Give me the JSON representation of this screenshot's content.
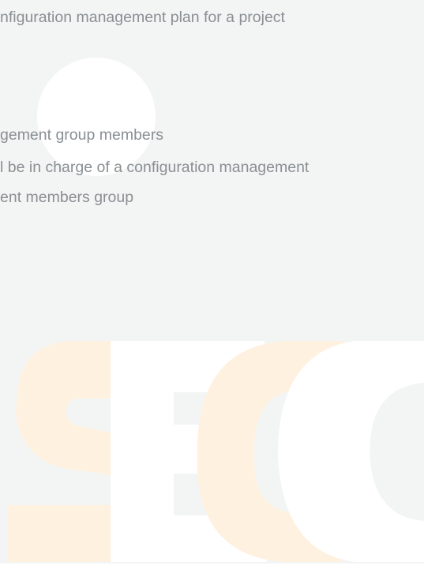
{
  "document": {
    "lines": [
      "nfiguration management plan for a project",
      "gement group members",
      "l be in charge of a configuration management",
      "ent members group"
    ]
  },
  "watermark": {
    "letters": "SEC",
    "colors": {
      "s": "#fff1df",
      "e": "#ffffff",
      "c_back": "#fff1df",
      "c_front": "#ffffff",
      "background": "#f3f5f4",
      "text": "#8a8f93"
    }
  }
}
